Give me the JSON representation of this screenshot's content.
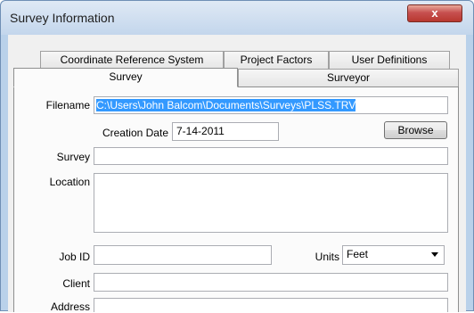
{
  "window": {
    "title": "Survey Information",
    "close_label": "x"
  },
  "tabs": {
    "row_back": [
      {
        "label": "Coordinate Reference System"
      },
      {
        "label": "Project Factors"
      },
      {
        "label": "User Definitions"
      }
    ],
    "row_front": [
      {
        "label": "Survey",
        "active": true
      },
      {
        "label": "Surveyor",
        "active": false
      }
    ]
  },
  "form": {
    "filename_label": "Filename",
    "filename_value": "C:\\Users\\John Balcom\\Documents\\Surveys\\PLSS.TRV",
    "creation_date_label": "Creation Date",
    "creation_date_value": "7-14-2011",
    "browse_label": "Browse",
    "survey_label": "Survey",
    "survey_value": "",
    "location_label": "Location",
    "location_value": "",
    "job_id_label": "Job ID",
    "job_id_value": "",
    "units_label": "Units",
    "units_value": "Feet",
    "client_label": "Client",
    "client_value": "",
    "address_label": "Address",
    "address_value": ""
  }
}
